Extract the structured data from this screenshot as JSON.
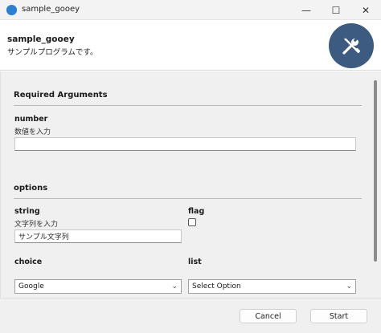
{
  "window": {
    "title": "sample_gooey",
    "minimize_glyph": "—",
    "maximize_glyph": "☐",
    "close_glyph": "✕"
  },
  "header": {
    "title": "sample_gooey",
    "subtitle": "サンプルプログラムです。",
    "icon": "tools-icon",
    "icon_bg": "#3d5a80"
  },
  "required_section": {
    "title": "Required Arguments",
    "number": {
      "label": "number",
      "help": "数値を入力",
      "value": ""
    }
  },
  "options_section": {
    "title": "options",
    "string": {
      "label": "string",
      "help": "文字列を入力",
      "value": "サンプル文字列"
    },
    "flag": {
      "label": "flag",
      "checked": false
    },
    "choice": {
      "label": "choice",
      "selected": "Google"
    },
    "list": {
      "label": "list",
      "selected": "Select Option"
    }
  },
  "footer": {
    "cancel_label": "Cancel",
    "start_label": "Start"
  }
}
